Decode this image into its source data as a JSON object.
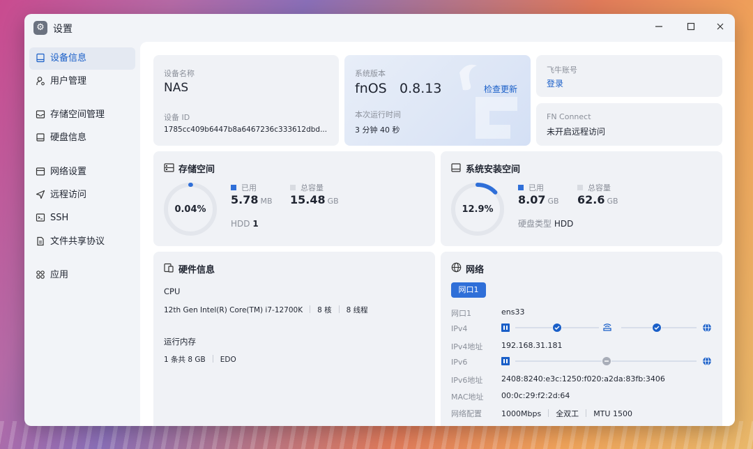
{
  "window": {
    "title": "设置"
  },
  "sidebar": {
    "items": [
      {
        "label": "设备信息",
        "icon": "device-icon"
      },
      {
        "label": "用户管理",
        "icon": "user-icon"
      },
      {
        "label": "存储空间管理",
        "icon": "storage-icon"
      },
      {
        "label": "硬盘信息",
        "icon": "disk-icon"
      },
      {
        "label": "网络设置",
        "icon": "network-icon"
      },
      {
        "label": "远程访问",
        "icon": "remote-icon"
      },
      {
        "label": "SSH",
        "icon": "terminal-icon"
      },
      {
        "label": "文件共享协议",
        "icon": "file-icon"
      },
      {
        "label": "应用",
        "icon": "apps-icon"
      }
    ]
  },
  "device": {
    "name_label": "设备名称",
    "name": "NAS",
    "id_label": "设备 ID",
    "id": "1785cc409b6447b8a6467236c333612dbd..."
  },
  "system": {
    "version_label": "系统版本",
    "version_name": "fnOS",
    "version_number": "0.8.13",
    "check_update": "检查更新",
    "uptime_label": "本次运行时间",
    "uptime": "3 分钟 40 秒"
  },
  "account": {
    "label": "飞牛账号",
    "login": "登录"
  },
  "fn_connect": {
    "label": "FN Connect",
    "status": "未开启远程访问"
  },
  "storage": {
    "title": "存储空间",
    "percent_text": "0.04%",
    "percent": 0.04,
    "used_label": "已用",
    "used_value": "5.78",
    "used_unit": "MB",
    "total_label": "总容量",
    "total_value": "15.48",
    "total_unit": "GB",
    "hdd_label": "HDD",
    "hdd_count": "1"
  },
  "system_space": {
    "title": "系统安装空间",
    "percent_text": "12.9%",
    "percent": 12.9,
    "used_label": "已用",
    "used_value": "8.07",
    "used_unit": "GB",
    "total_label": "总容量",
    "total_value": "62.6",
    "total_unit": "GB",
    "disk_type_label": "硬盘类型",
    "disk_type": "HDD"
  },
  "hardware": {
    "title": "硬件信息",
    "cpu_label": "CPU",
    "cpu_model": "12th Gen Intel(R) Core(TM) i7-12700K",
    "cpu_cores": "8 核",
    "cpu_threads": "8 线程",
    "memory_label": "运行内存",
    "memory_size": "1 条共 8 GB",
    "memory_type": "EDO"
  },
  "network": {
    "title": "网络",
    "tab": "网口1",
    "port_label": "网口1",
    "port_value": "ens33",
    "ipv4_label": "IPv4",
    "ipv4_addr_label": "IPv4地址",
    "ipv4_addr": "192.168.31.181",
    "ipv6_label": "IPv6",
    "ipv6_addr_label": "IPv6地址",
    "ipv6_addr": "2408:8240:e3c:1250:f020:a2da:83fb:3406",
    "mac_label": "MAC地址",
    "mac": "00:0c:29:f2:2d:64",
    "config_label": "网络配置",
    "speed": "1000Mbps",
    "duplex": "全双工",
    "mtu": "MTU 1500"
  },
  "colors": {
    "accent": "#2f6fd8",
    "ring_track": "#e3e6ec",
    "muted": "#8a8f99"
  }
}
